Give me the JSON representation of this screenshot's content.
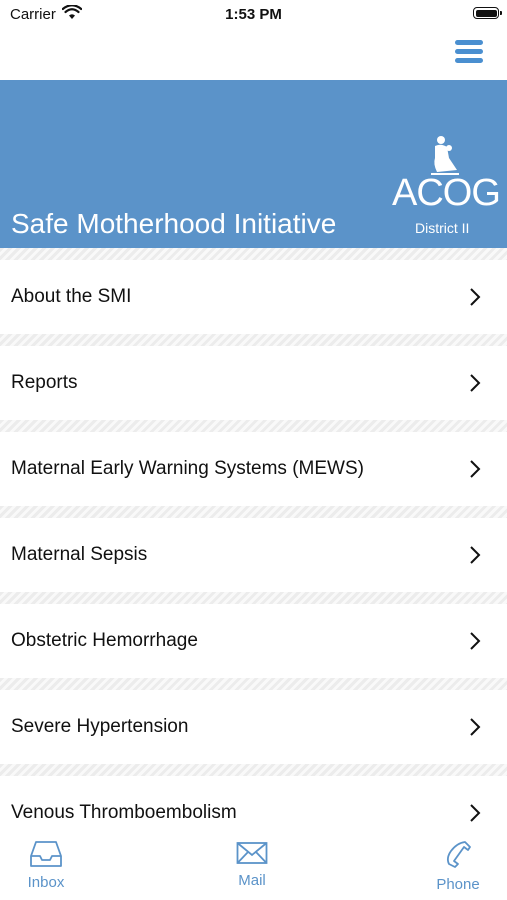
{
  "status": {
    "carrier": "Carrier",
    "time": "1:53 PM"
  },
  "header": {
    "menu_icon": "hamburger-menu-icon",
    "accent": "#4a8fd0"
  },
  "banner": {
    "title": "Safe Motherhood Initiative",
    "logo_text": "ACOG",
    "logo_sub": "District II",
    "background": "#5b93c9"
  },
  "menu": {
    "items": [
      {
        "label": "About the SMI"
      },
      {
        "label": "Reports"
      },
      {
        "label": "Maternal Early Warning Systems (MEWS)"
      },
      {
        "label": "Maternal Sepsis"
      },
      {
        "label": "Obstetric Hemorrhage"
      },
      {
        "label": "Severe Hypertension"
      },
      {
        "label": "Venous Thromboembolism"
      }
    ]
  },
  "tabbar": {
    "tabs": [
      {
        "label": "Inbox",
        "icon": "inbox-icon"
      },
      {
        "label": "Mail",
        "icon": "mail-icon"
      },
      {
        "label": "Phone",
        "icon": "phone-icon"
      }
    ]
  }
}
